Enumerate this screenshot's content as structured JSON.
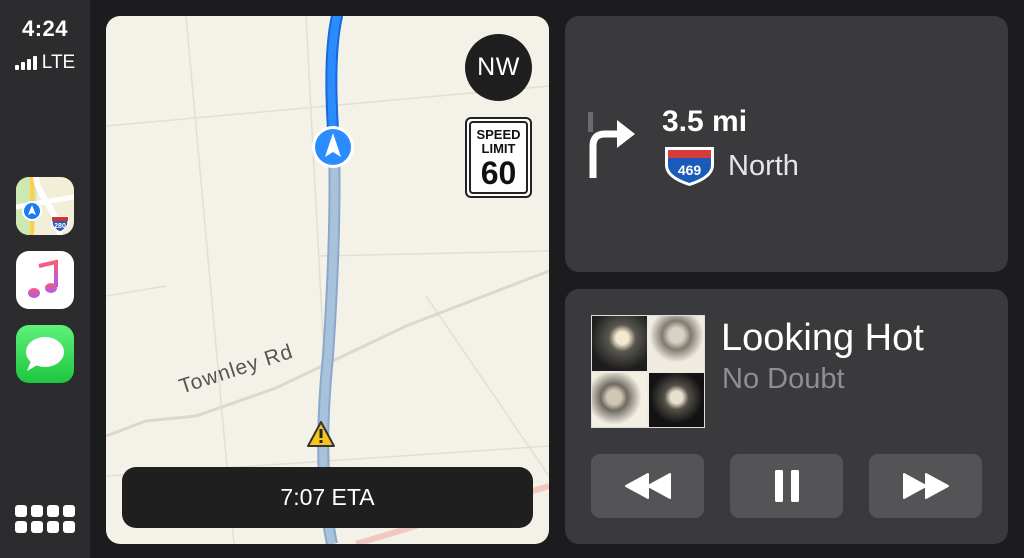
{
  "status": {
    "time": "4:24",
    "network": "LTE"
  },
  "dock": {
    "apps": [
      {
        "name": "Maps",
        "icon": "maps-icon",
        "badge": "280"
      },
      {
        "name": "Music",
        "icon": "music-note-icon"
      },
      {
        "name": "Messages",
        "icon": "speech-bubble-icon"
      }
    ],
    "grid_icon": "app-grid-icon"
  },
  "map": {
    "compass": "NW",
    "speed_limit": {
      "label_line1": "SPEED",
      "label_line2": "LIMIT",
      "value": "60"
    },
    "road_name": "Townley Rd",
    "eta": "7:07 ETA",
    "colors": {
      "route": "#1a8cff",
      "route_ahead": "#a9bfd6",
      "land": "#f4f1e8"
    }
  },
  "navigation": {
    "distance": "3.5 mi",
    "shield_number": "469",
    "direction": "North",
    "turn": "right-turn-arrow-icon"
  },
  "now_playing": {
    "title": "Looking Hot",
    "artist": "No Doubt",
    "controls": [
      "rewind-icon",
      "pause-icon",
      "fast-forward-icon"
    ]
  }
}
